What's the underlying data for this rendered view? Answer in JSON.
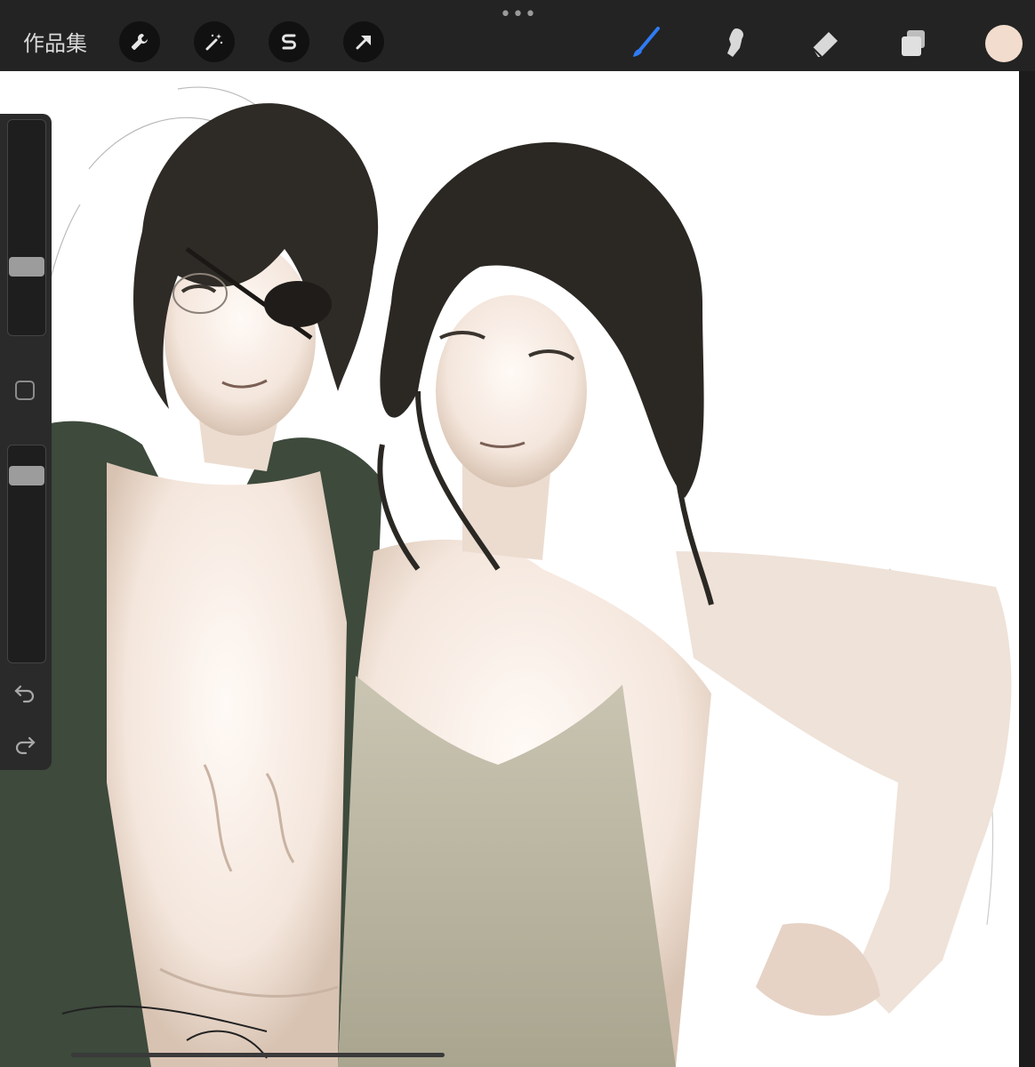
{
  "app": {
    "gallery_label": "作品集",
    "more_icon": "ellipsis-icon"
  },
  "toolbar": {
    "left_tools": [
      "wrench-icon",
      "magic-wand-icon",
      "selection-s-icon",
      "transform-arrow-icon"
    ],
    "right_tools": [
      "brush-icon",
      "smudge-icon",
      "eraser-icon",
      "layers-icon"
    ],
    "active_tool": "brush-icon",
    "active_color": "#2f7bf5",
    "current_color": "#f2dccd"
  },
  "sidebar": {
    "brush_size_level": 0.3,
    "opacity_level": 0.9,
    "modifier_icon": "square-modifier-icon",
    "undo_icon": "undo-icon",
    "redo_icon": "redo-icon"
  }
}
